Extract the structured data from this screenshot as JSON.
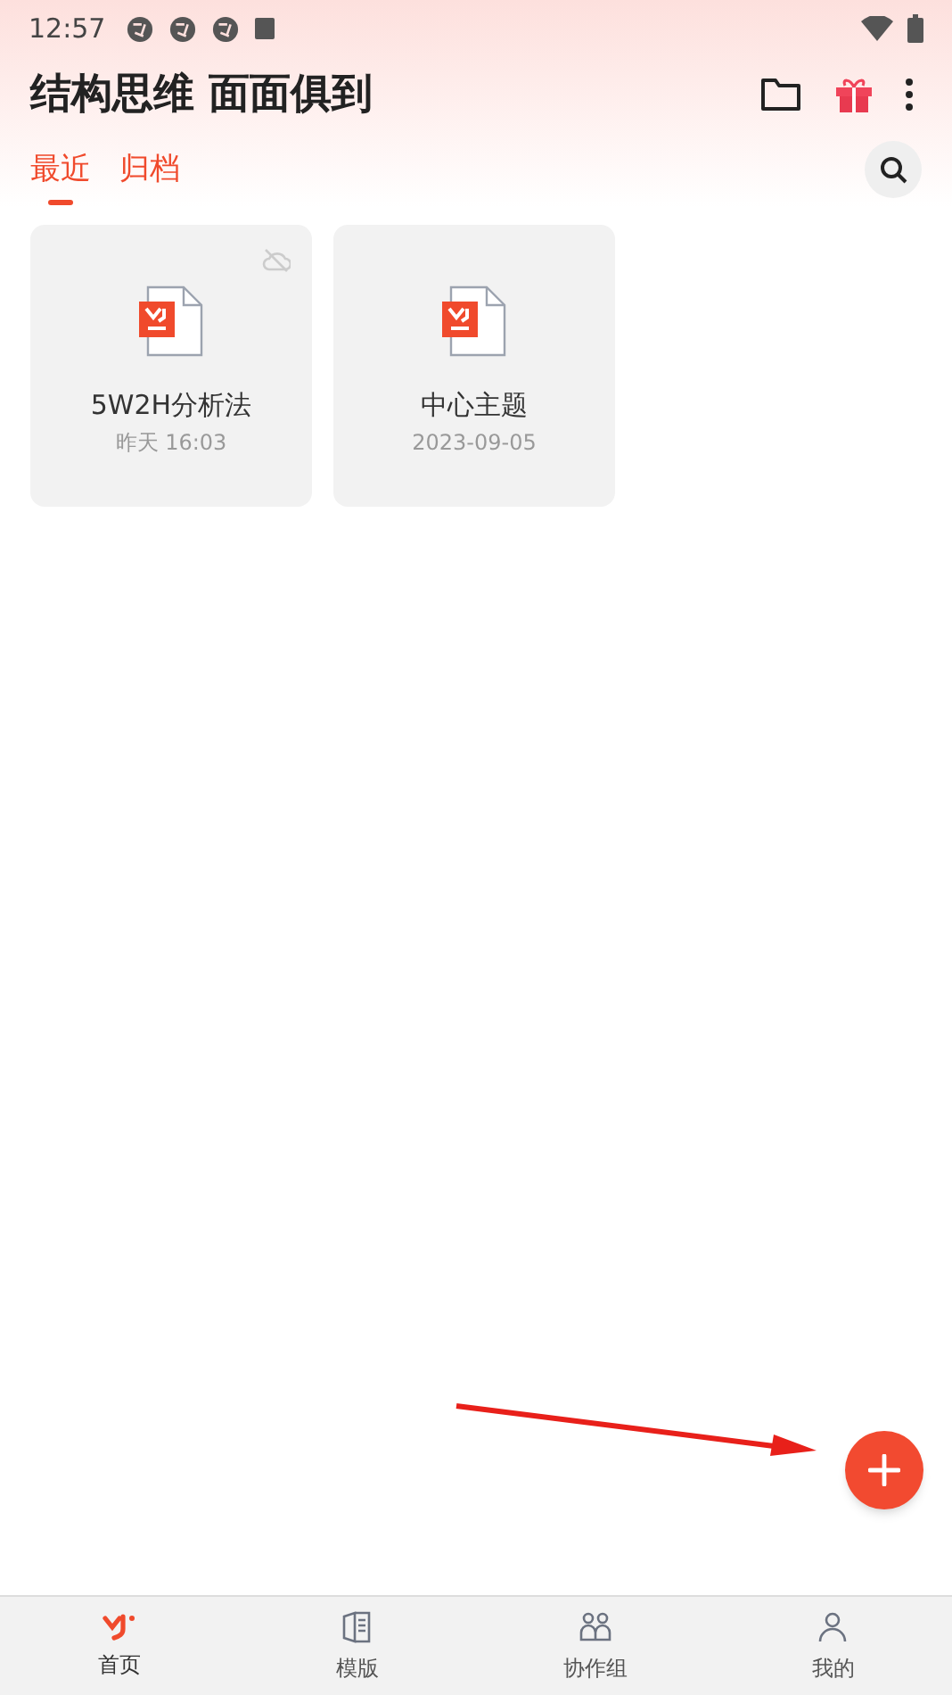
{
  "status_bar": {
    "time": "12:57"
  },
  "header": {
    "title": "结构思维 面面俱到"
  },
  "tabs": [
    {
      "label": "最近",
      "selected": true
    },
    {
      "label": "归档",
      "selected": false
    }
  ],
  "files": [
    {
      "name": "5W2H分析法",
      "date": "昨天 16:03",
      "cloud_off": true
    },
    {
      "name": "中心主题",
      "date": "2023-09-05",
      "cloud_off": false
    }
  ],
  "bottom_nav": [
    {
      "label": "首页",
      "kind": "home",
      "selected": true
    },
    {
      "label": "模版",
      "kind": "template",
      "selected": false
    },
    {
      "label": "协作组",
      "kind": "team",
      "selected": false
    },
    {
      "label": "我的",
      "kind": "me",
      "selected": false
    }
  ]
}
